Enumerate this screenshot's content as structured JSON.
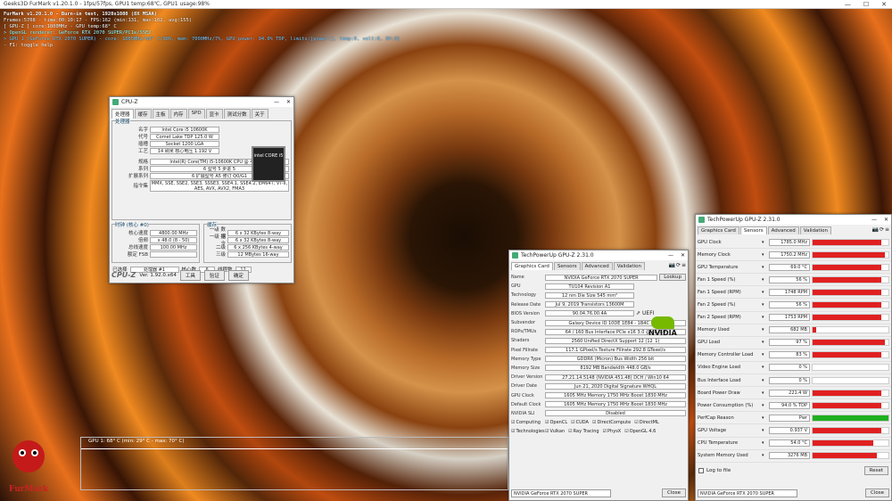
{
  "app": {
    "title": "Geeks3D FurMark v1.20.1.0 - 1fps/57fps, GPU1 temp:68℃, GPU1 usage:98%",
    "win_min": "—",
    "win_max": "☐",
    "win_close": "✕"
  },
  "hud": {
    "line1": "FurMark v1.20.1.0 - Burn-in test, 1920x1080 (8X MSAA)",
    "line2": "Frames:5708 - time:00:10:17 - FPS:162 (min:131, max:162, avg:155)",
    "line3": "[ GPU-Z ] core:1800MHz - GPU temp:68° C",
    "line4": "> OpenGL renderer: GeForce RTX 2070 SUPER/PCIe/SSE2",
    "line5": "> GPU 1 (GeForce RTX 2070 SUPER) - core: 1665MHz/68° C/98%, mem: 7000MHz/7%, GPU power: 94.0% TDP, limits:[power:1, temp:0, volt:0, OV:0]",
    "line6": "- F1: toggle help"
  },
  "graph": {
    "label": "GPU 1: 68° C (min: 29° C - max: 70° C)"
  },
  "logo": {
    "text": "FurMark"
  },
  "cpuz": {
    "title": "CPU-Z",
    "tabs": [
      "处理器",
      "缓存",
      "主板",
      "内存",
      "SPD",
      "显卡",
      "测试分数",
      "关于"
    ],
    "proc_legend": "处理器",
    "rows": [
      {
        "k": "名字",
        "v": "Intel Core i5 10600K"
      },
      {
        "k": "代号",
        "v": "Comet Lake   TDP  125.0 W"
      },
      {
        "k": "插槽",
        "v": "Socket 1200 LGA"
      },
      {
        "k": "工艺",
        "v": "14 纳米   核心电压  1.192 V"
      },
      {
        "k": "规格",
        "v": "Intel(R) Core(TM) i5-10600K CPU @ 4.10GHz"
      },
      {
        "k": "系列",
        "v": "6   型号  5   步进  5"
      },
      {
        "k": "扩展系列",
        "v": "6   扩展型号  A5   修订  Q0/G1"
      },
      {
        "k": "指令集",
        "v": "MMX, SSE, SSE2, SSE3, SSSE3, SSE4.1, SSE4.2, EM64T, VT-x, AES, AVX, AVX2, FMA3"
      }
    ],
    "intel": "intel CORE i5",
    "clock_legend": "时钟 (核心 #0)",
    "cache_legend": "缓存",
    "clock": [
      {
        "k": "核心速度",
        "v": "4800.00 MHz"
      },
      {
        "k": "倍频",
        "v": "x 48.0 (8 - 50)"
      },
      {
        "k": "总线速度",
        "v": "100.00 MHz"
      },
      {
        "k": "额定 FSB",
        "v": ""
      }
    ],
    "cache": [
      {
        "k": "一级 数据",
        "v": "6 x 32 KBytes  8-way"
      },
      {
        "k": "一级 指令",
        "v": "6 x 32 KBytes  8-way"
      },
      {
        "k": "二级",
        "v": "6 x 256 KBytes  4-way"
      },
      {
        "k": "三级",
        "v": "12 MBytes  16-way"
      }
    ],
    "sel_label": "已选择",
    "sel_value": "处理器 #1",
    "cores_label": "核心数",
    "cores": "6",
    "threads_label": "线程数",
    "threads": "12",
    "brand": "CPU-Z",
    "ver": "Ver. 1.92.0.x64",
    "tools": "工具",
    "validate": "验证",
    "ok": "确定"
  },
  "gpuz": {
    "title": "TechPowerUp GPU-Z 2.31.0",
    "tabs": [
      "Graphics Card",
      "Sensors",
      "Advanced",
      "Validation"
    ],
    "lookup": "Lookup",
    "uefi": "UEFI",
    "rows": [
      {
        "k": "Name",
        "v": "NVIDIA GeForce RTX 2070 SUPER"
      },
      {
        "k": "GPU",
        "v": "TU104     Revision  A1"
      },
      {
        "k": "Technology",
        "v": "12 nm   Die Size  545 mm²"
      },
      {
        "k": "Release Date",
        "v": "Jul 9, 2019   Transistors  13600M"
      },
      {
        "k": "BIOS Version",
        "v": "90.04.76.00.4A"
      },
      {
        "k": "Subvendor",
        "v": "Galaxy   Device ID  10DE 1E84 - 1B4C 139B"
      },
      {
        "k": "ROPs/TMUs",
        "v": "64 / 160   Bus Interface  PCIe x16 3.0 @ x8 3.0"
      },
      {
        "k": "Shaders",
        "v": "2560 Unified   DirectX Support  12 (12_1)"
      },
      {
        "k": "Pixel Fillrate",
        "v": "117.1 GPixel/s   Texture Fillrate  292.8 GTexel/s"
      },
      {
        "k": "Memory Type",
        "v": "GDDR6 (Micron)   Bus Width  256 bit"
      },
      {
        "k": "Memory Size",
        "v": "8192 MB   Bandwidth  448.0 GB/s"
      },
      {
        "k": "Driver Version",
        "v": "27.21.14.5148 (NVIDIA 451.48) DCH / Win10 64"
      },
      {
        "k": "Driver Date",
        "v": "Jun 21, 2020   Digital Signature  WHQL"
      },
      {
        "k": "GPU Clock",
        "v": "1605 MHz  Memory 1750 MHz  Boost 1830 MHz"
      },
      {
        "k": "Default Clock",
        "v": "1605 MHz  Memory 1750 MHz  Boost 1830 MHz"
      },
      {
        "k": "NVIDIA SLI",
        "v": "Disabled"
      }
    ],
    "computing_label": "Computing",
    "computing": [
      "OpenCL",
      "CUDA",
      "DirectCompute",
      "DirectML"
    ],
    "tech_label": "Technologies",
    "tech": [
      "Vulkan",
      "Ray Tracing",
      "PhysX",
      "OpenGL 4.6"
    ],
    "nvidia": "NVIDIA",
    "select": "NVIDIA GeForce RTX 2070 SUPER",
    "close": "Close"
  },
  "sensors": {
    "title": "TechPowerUp GPU-Z 2.31.0",
    "tabs": [
      "Graphics Card",
      "Sensors",
      "Advanced",
      "Validation"
    ],
    "rows": [
      {
        "n": "GPU Clock",
        "v": "1785.0 MHz",
        "p": 0.9,
        "c": "#e02020"
      },
      {
        "n": "Memory Clock",
        "v": "1750.2 MHz",
        "p": 0.95,
        "c": "#e02020"
      },
      {
        "n": "GPU Temperature",
        "v": "69.0 °C",
        "p": 0.9,
        "c": "#e02020"
      },
      {
        "n": "Fan 1 Speed (%)",
        "v": "56 %",
        "p": 0.9,
        "c": "#e02020"
      },
      {
        "n": "Fan 1 Speed (RPM)",
        "v": "1748 RPM",
        "p": 0.9,
        "c": "#e02020"
      },
      {
        "n": "Fan 2 Speed (%)",
        "v": "56 %",
        "p": 0.9,
        "c": "#e02020"
      },
      {
        "n": "Fan 2 Speed (RPM)",
        "v": "1753 RPM",
        "p": 0.9,
        "c": "#e02020"
      },
      {
        "n": "Memory Used",
        "v": "682 MB",
        "p": 0.05,
        "c": "#e02020"
      },
      {
        "n": "GPU Load",
        "v": "97 %",
        "p": 0.95,
        "c": "#e02020"
      },
      {
        "n": "Memory Controller Load",
        "v": "83 %",
        "p": 0.9,
        "c": "#e02020"
      },
      {
        "n": "Video Engine Load",
        "v": "0 %",
        "p": 0,
        "c": "#e02020"
      },
      {
        "n": "Bus Interface Load",
        "v": "0 %",
        "p": 0,
        "c": "#e02020"
      },
      {
        "n": "Board Power Draw",
        "v": "221.4 W",
        "p": 0.9,
        "c": "#e02020"
      },
      {
        "n": "Power Consumption (%)",
        "v": "94.0 % TDP",
        "p": 0.9,
        "c": "#e02020"
      },
      {
        "n": "PerfCap Reason",
        "v": "Pwr",
        "p": 1,
        "c": "#20b020"
      },
      {
        "n": "GPU Voltage",
        "v": "0.937 V",
        "p": 0.9,
        "c": "#e02020"
      },
      {
        "n": "CPU Temperature",
        "v": "54.0 °C",
        "p": 0.8,
        "c": "#e02020"
      },
      {
        "n": "System Memory Used",
        "v": "3276 MB",
        "p": 0.85,
        "c": "#e02020"
      }
    ],
    "log": "Log to file",
    "reset": "Reset",
    "select": "NVIDIA GeForce RTX 2070 SUPER",
    "close": "Close"
  }
}
